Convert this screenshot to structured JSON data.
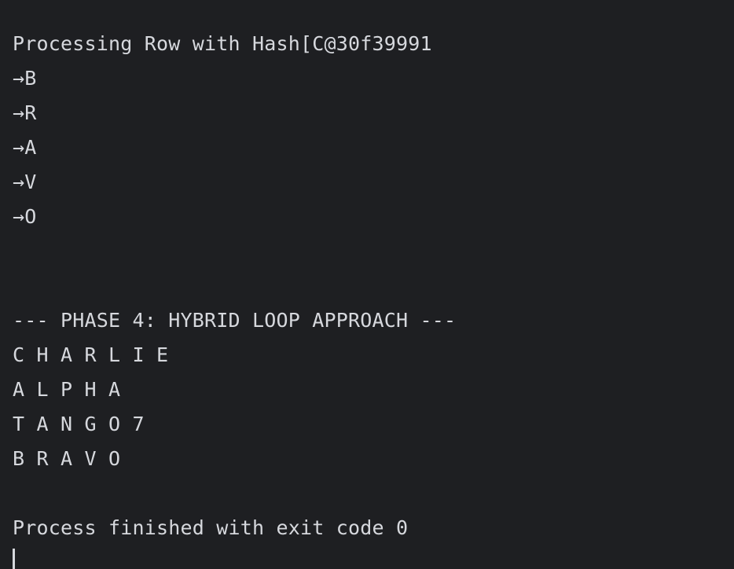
{
  "console": {
    "lines": [
      "Processing Row with Hash[C@30f39991",
      "→B",
      "→R",
      "→A",
      "→V",
      "→O",
      "",
      "",
      "--- PHASE 4: HYBRID LOOP APPROACH ---",
      "C H A R L I E",
      "A L P H A",
      "T A N G O 7",
      "B R A V O",
      "",
      "Process finished with exit code 0"
    ]
  }
}
